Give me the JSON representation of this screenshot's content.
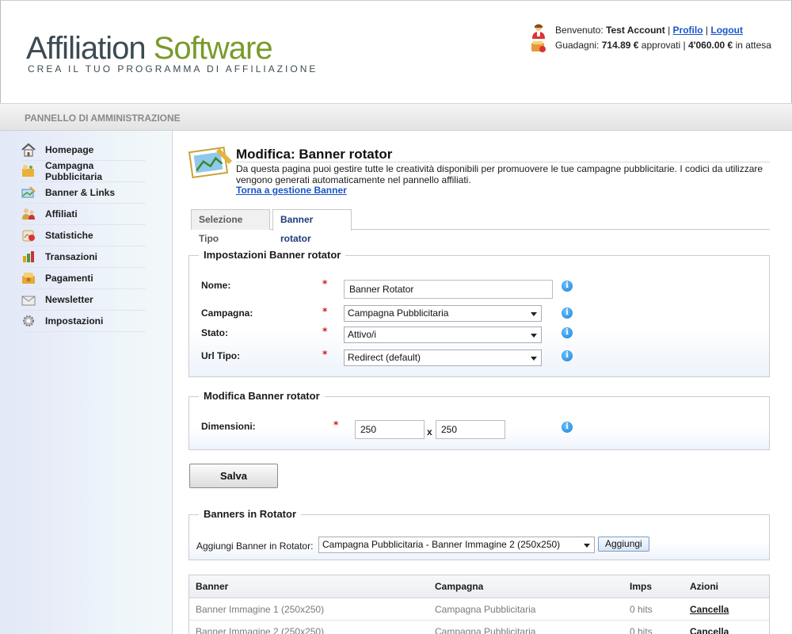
{
  "header": {
    "logo_word1": "Affiliation",
    "logo_word2": "Software",
    "tagline": "CREA IL TUO PROGRAMMA DI AFFILIAZIONE",
    "welcome_label": "Benvenuto:",
    "account_name": "Test Account",
    "sep": "|",
    "profile_link": "Profilo",
    "logout_link": "Logout",
    "earnings_label": "Guadagni:",
    "approved_amount": "714.89 €",
    "approved_label": "approvati |",
    "pending_amount": "4'060.00 €",
    "pending_label": "in attesa"
  },
  "admin_bar": {
    "label": "PANNELLO DI AMMINISTRAZIONE"
  },
  "sidebar": {
    "items": [
      {
        "label": "Homepage",
        "icon": "home-icon"
      },
      {
        "label": "Campagna Pubblicitaria",
        "icon": "campaign-icon"
      },
      {
        "label": "Banner & Links",
        "icon": "banner-icon"
      },
      {
        "label": "Affiliati",
        "icon": "affiliates-icon"
      },
      {
        "label": "Statistiche",
        "icon": "statistics-icon"
      },
      {
        "label": "Transazioni",
        "icon": "transactions-icon"
      },
      {
        "label": "Pagamenti",
        "icon": "payments-icon"
      },
      {
        "label": "Newsletter",
        "icon": "newsletter-icon"
      },
      {
        "label": "Impostazioni",
        "icon": "settings-icon"
      }
    ]
  },
  "page": {
    "title": "Modifica: Banner rotator",
    "description": "Da questa pagina puoi gestire tutte le creatività disponibili per promuovere le tue campagne pubblicitarie. I codici da utilizzare vengono generati automaticamente nel pannello affiliati.",
    "back_link": "Torna a gestione Banner"
  },
  "tabs": [
    {
      "label": "Selezione Tipo",
      "active": false
    },
    {
      "label": "Banner rotator",
      "active": true
    }
  ],
  "settings_box": {
    "legend": "Impostazioni Banner rotator",
    "name_label": "Nome:",
    "name_value": "Banner Rotator",
    "campaign_label": "Campagna:",
    "campaign_value": "Campagna Pubblicitaria",
    "status_label": "Stato:",
    "status_value": "Attivo/i",
    "urltype_label": "Url Tipo:",
    "urltype_value": "Redirect (default)",
    "required_mark": "*"
  },
  "edit_box": {
    "legend": "Modifica Banner rotator",
    "dims_label": "Dimensioni:",
    "width_value": "250",
    "height_value": "250",
    "dims_sep": "x"
  },
  "save_button": "Salva",
  "rotator_box": {
    "legend": "Banners in Rotator",
    "add_label": "Aggiungi Banner in Rotator:",
    "add_select_value": "Campagna Pubblicitaria - Banner Immagine 2 (250x250)",
    "add_button": "Aggiungi"
  },
  "banner_table": {
    "headers": [
      "Banner",
      "Campagna",
      "Imps",
      "Azioni"
    ],
    "rows": [
      {
        "banner": "Banner Immagine 1 (250x250)",
        "campaign": "Campagna Pubblicitaria",
        "imps": "0 hits",
        "action": "Cancella"
      },
      {
        "banner": "Banner Immagine 2 (250x250)",
        "campaign": "Campagna Pubblicitaria",
        "imps": "0 hits",
        "action": "Cancella"
      }
    ]
  },
  "colors": {
    "link": "#1a56c9",
    "logo_dark": "#3c4a52",
    "logo_green": "#7a9a2a",
    "required": "#d21818",
    "info": "#1a7fd6"
  }
}
